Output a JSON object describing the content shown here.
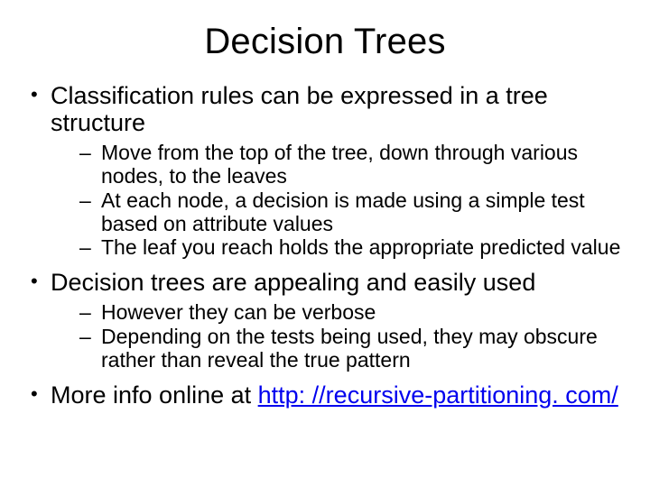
{
  "title": "Decision Trees",
  "bullets": [
    {
      "text": "Classification rules can be expressed in a tree structure",
      "sub": [
        "Move from the top of the tree, down through various nodes, to the leaves",
        "At each node, a decision is made using a simple test based on attribute values",
        "The leaf you reach holds the appropriate predicted value"
      ]
    },
    {
      "text": "Decision trees are appealing and easily used",
      "sub": [
        "However they can be verbose",
        "Depending on the tests being used, they may obscure rather than reveal the true pattern"
      ]
    },
    {
      "text_prefix": "More info online at ",
      "link_text": "http: //recursive-partitioning. com/",
      "link_href": "http://recursive-partitioning.com/",
      "sub": []
    }
  ]
}
